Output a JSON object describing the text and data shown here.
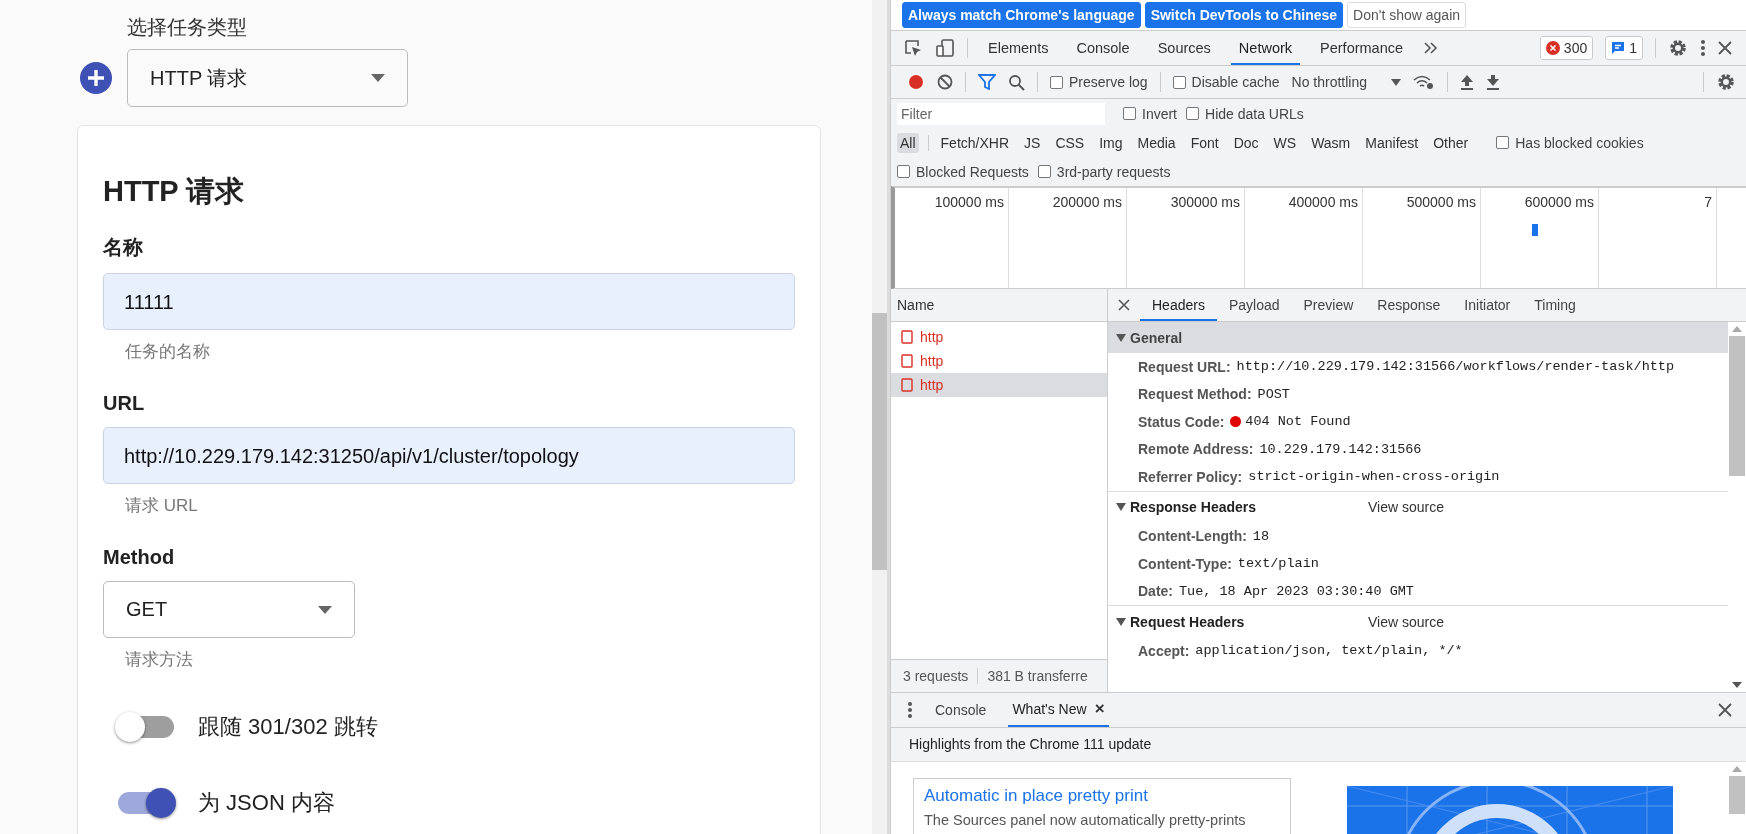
{
  "page": {
    "task_type_label": "选择任务类型",
    "task_type_value": "HTTP 请求",
    "card": {
      "title": "HTTP 请求",
      "fields": [
        {
          "kind": "input",
          "label": "名称",
          "value": "11111",
          "helper": "任务的名称"
        },
        {
          "kind": "input",
          "label": "URL",
          "value": "http://10.229.179.142:31250/api/v1/cluster/topology",
          "helper": "请求 URL"
        },
        {
          "kind": "select",
          "label": "Method",
          "value": "GET",
          "helper": "请求方法"
        }
      ],
      "switches": [
        {
          "label": "跟随 301/302 跳转",
          "on": false
        },
        {
          "label": "为 JSON 内容",
          "on": true
        }
      ]
    }
  },
  "devtools": {
    "infobar_buttons": [
      {
        "label": "Always match Chrome's language",
        "kind": "primary"
      },
      {
        "label": "Switch DevTools to Chinese",
        "kind": "primary"
      },
      {
        "label": "Don't show again",
        "kind": "plain"
      }
    ],
    "tabs": [
      {
        "label": "Elements",
        "selected": false
      },
      {
        "label": "Console",
        "selected": false
      },
      {
        "label": "Sources",
        "selected": false
      },
      {
        "label": "Network",
        "selected": true
      },
      {
        "label": "Performance",
        "selected": false
      }
    ],
    "error_count": "300",
    "message_count": "1",
    "toolbar": {
      "recording": true,
      "checks": [
        {
          "label": "Preserve log",
          "checked": false
        },
        {
          "label": "Disable cache",
          "checked": false
        }
      ],
      "throttling": "No throttling"
    },
    "filter": {
      "placeholder": "Filter"
    },
    "filter_checks": [
      {
        "label": "Invert",
        "checked": false
      },
      {
        "label": "Hide data URLs",
        "checked": false
      }
    ],
    "type_filters": [
      {
        "label": "All",
        "selected": true
      },
      {
        "label": "Fetch/XHR",
        "selected": false
      },
      {
        "label": "JS",
        "selected": false
      },
      {
        "label": "CSS",
        "selected": false
      },
      {
        "label": "Img",
        "selected": false
      },
      {
        "label": "Media",
        "selected": false
      },
      {
        "label": "Font",
        "selected": false
      },
      {
        "label": "Doc",
        "selected": false
      },
      {
        "label": "WS",
        "selected": false
      },
      {
        "label": "Wasm",
        "selected": false
      },
      {
        "label": "Manifest",
        "selected": false
      },
      {
        "label": "Other",
        "selected": false
      }
    ],
    "type_checks": [
      {
        "label": "Has blocked cookies",
        "checked": false
      }
    ],
    "extra_checks": [
      {
        "label": "Blocked Requests",
        "checked": false
      },
      {
        "label": "3rd-party requests",
        "checked": false
      }
    ],
    "timeline_ticks": [
      "100000 ms",
      "200000 ms",
      "300000 ms",
      "400000 ms",
      "500000 ms",
      "600000 ms",
      "7"
    ],
    "name_header": "Name",
    "requests": [
      {
        "name": "http",
        "failed": true,
        "selected": false
      },
      {
        "name": "http",
        "failed": true,
        "selected": false
      },
      {
        "name": "http",
        "failed": true,
        "selected": true
      }
    ],
    "summary": [
      "3 requests",
      "381 B transferre"
    ],
    "detail_tabs": [
      {
        "label": "Headers",
        "selected": true
      },
      {
        "label": "Payload",
        "selected": false
      },
      {
        "label": "Preview",
        "selected": false
      },
      {
        "label": "Response",
        "selected": false
      },
      {
        "label": "Initiator",
        "selected": false
      },
      {
        "label": "Timing",
        "selected": false
      }
    ],
    "sections": [
      {
        "title": "General",
        "expanded": true,
        "highlighted": true,
        "rows": [
          {
            "key": "Request URL:",
            "value": "http://10.229.179.142:31566/workflows/render-task/http"
          },
          {
            "key": "Request Method:",
            "value": "POST"
          },
          {
            "key": "Status Code:",
            "value": "404 Not Found",
            "color": "#e00000"
          },
          {
            "key": "Remote Address:",
            "value": "10.229.179.142:31566"
          },
          {
            "key": "Referrer Policy:",
            "value": "strict-origin-when-cross-origin"
          }
        ]
      },
      {
        "title": "Response Headers",
        "link": "View source",
        "expanded": true,
        "highlighted": false,
        "rows": [
          {
            "key": "Content-Length:",
            "value": "18"
          },
          {
            "key": "Content-Type:",
            "value": "text/plain"
          },
          {
            "key": "Date:",
            "value": "Tue, 18 Apr 2023 03:30:40 GMT"
          }
        ]
      },
      {
        "title": "Request Headers",
        "link": "View source",
        "expanded": true,
        "highlighted": false,
        "rows": [
          {
            "key": "Accept:",
            "value": "application/json, text/plain, */*"
          }
        ]
      }
    ],
    "drawer_tabs": [
      {
        "label": "Console",
        "selected": false,
        "closable": false
      },
      {
        "label": "What's New",
        "selected": true,
        "closable": true
      }
    ],
    "close_glyph": "×",
    "highlights": "Highlights from the Chrome 111 update",
    "news": {
      "title": "Automatic in place pretty print",
      "text": "The Sources panel now automatically pretty-prints",
      "kind": "picture"
    }
  }
}
